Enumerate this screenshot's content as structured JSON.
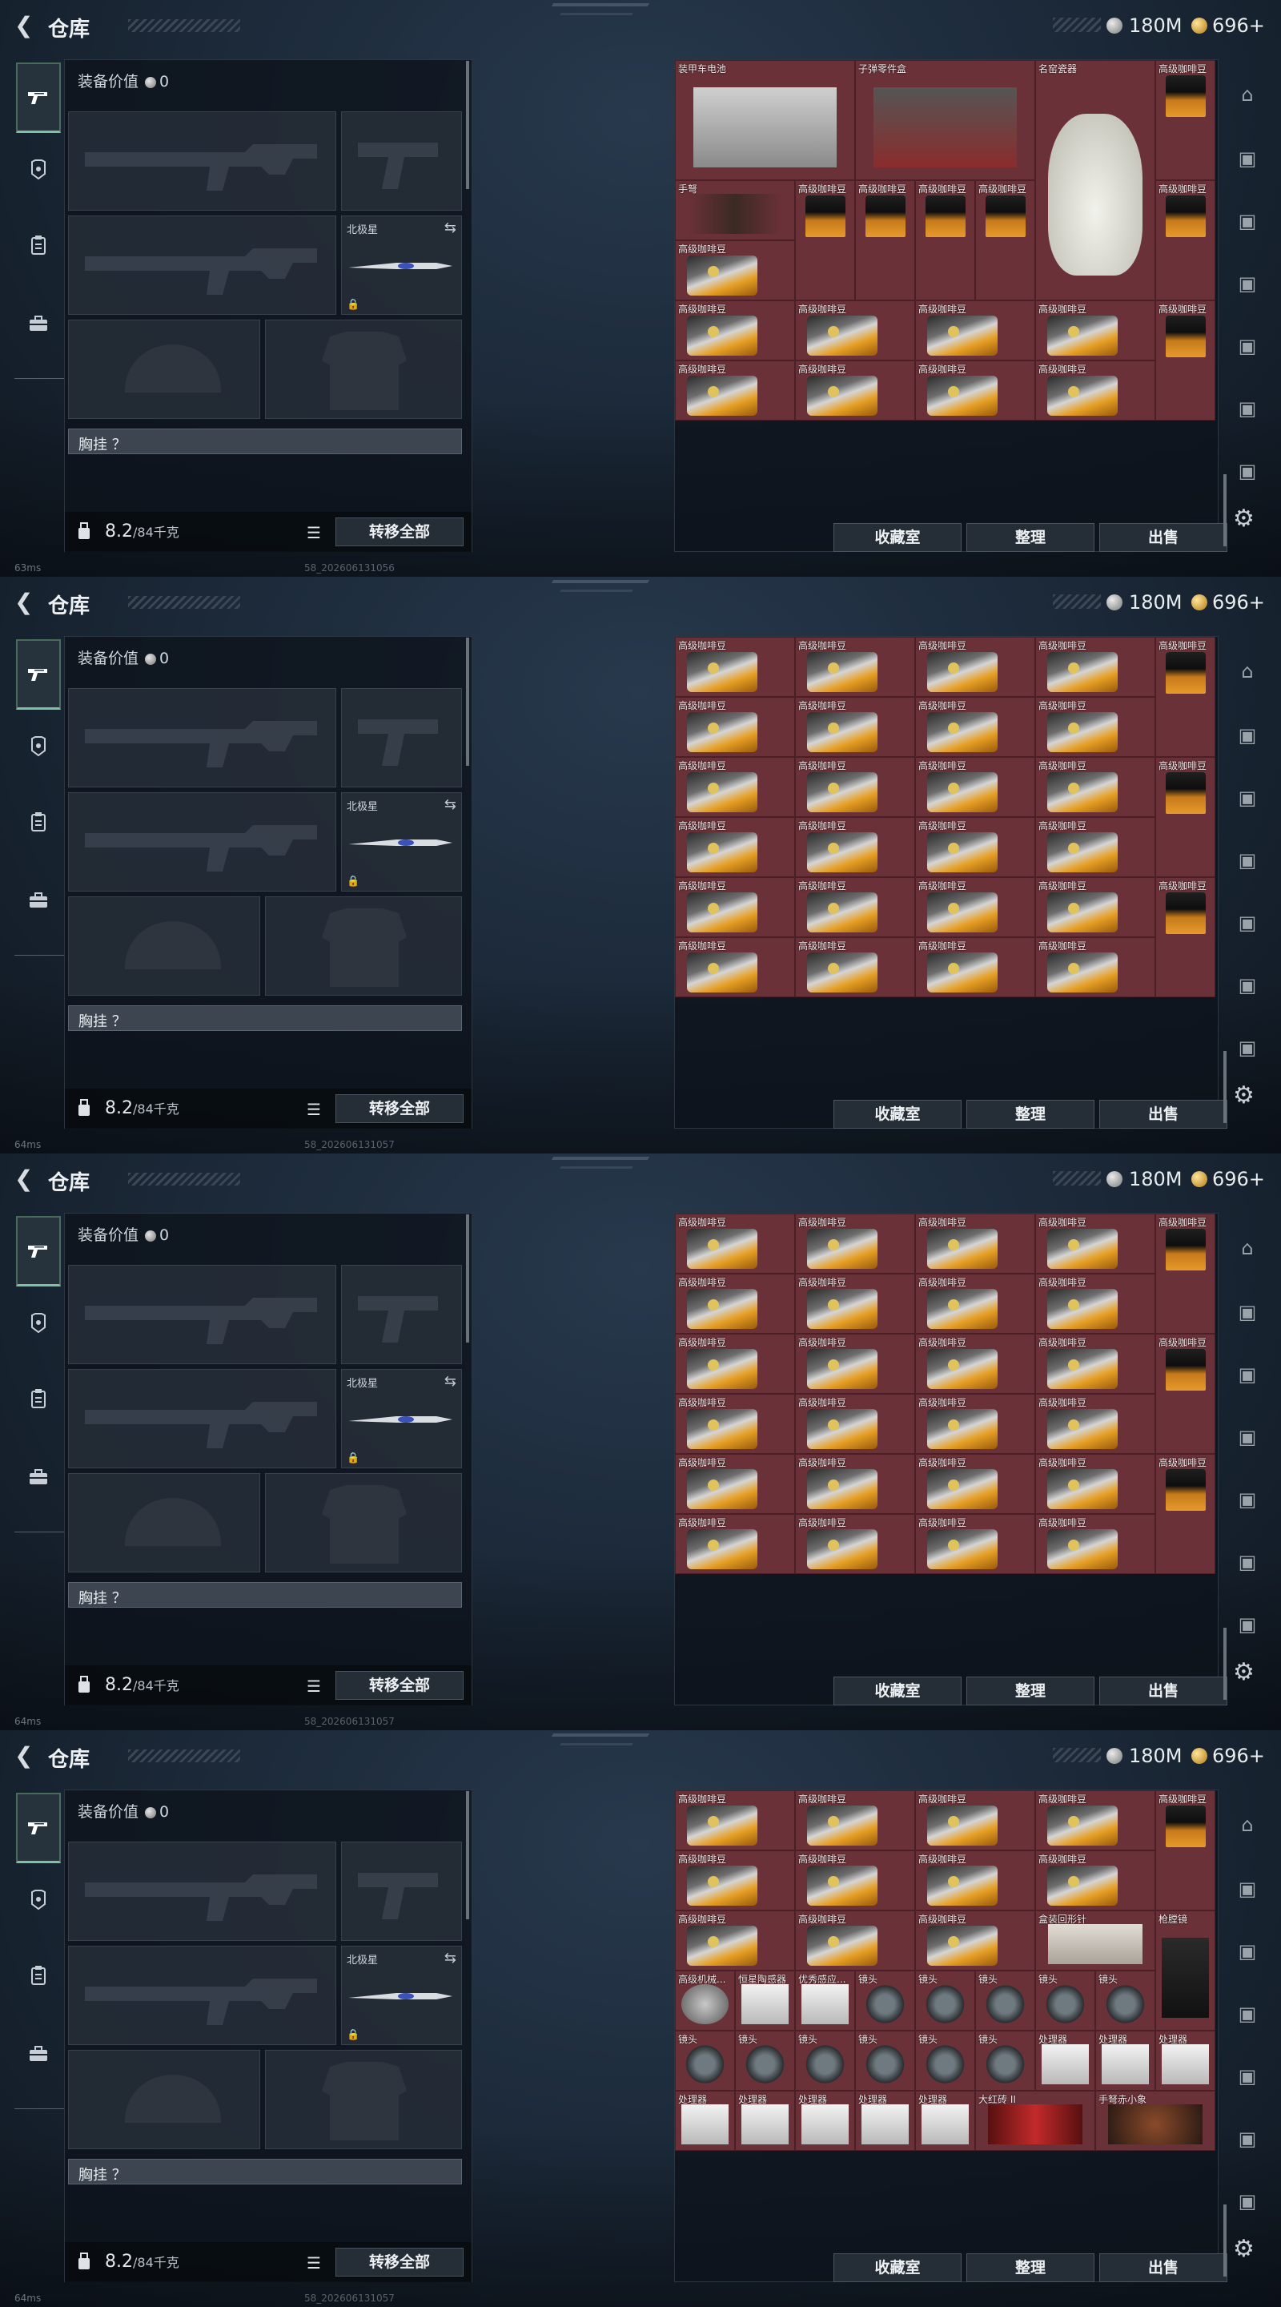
{
  "header": {
    "back_icon": "back-arrow-icon",
    "title": "仓库",
    "money": "180M",
    "points": "696+"
  },
  "loadout": {
    "equip_value_label": "装备价值",
    "equip_value": "0",
    "secure_case_label": "北极星",
    "chest_rig_label": "胸挂 ？",
    "weight_current": "8.2",
    "weight_max": "/84千克",
    "transfer_all": "转移全部"
  },
  "buttons": {
    "collection": "收藏室",
    "sort": "整理",
    "sell": "出售"
  },
  "items": {
    "coffee": "高级咖啡豆",
    "armor_battery": "装甲车电池",
    "bullet_parts": "子弹零件盒",
    "vase": "名窑瓷器",
    "crossbow": "手弩",
    "box": "盒装回形针",
    "gun_cleaner": "枪膛镜",
    "lens": "镜头",
    "processor": "处理器",
    "brain_sensor": "高级机械...",
    "star_sensor": "恒星陶感器",
    "optimizer": "优秀感应...",
    "big_red_brick": "大红砖 II",
    "handbook_small": "手弩赤小象"
  },
  "panels": [
    {
      "ping": "63ms",
      "build": "58_202606131056"
    },
    {
      "ping": "64ms",
      "build": "58_202606131057"
    },
    {
      "ping": "64ms",
      "build": "58_202606131057"
    },
    {
      "ping": "64ms",
      "build": "58_202606131057"
    }
  ],
  "colors": {
    "cell_bg": "#6b3138",
    "active_tab": "#7dc3a1",
    "panel_bg": "#0e141c"
  }
}
